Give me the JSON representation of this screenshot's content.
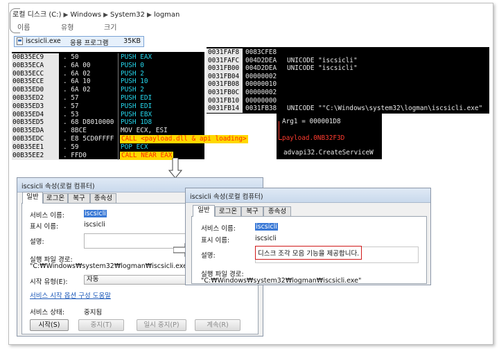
{
  "explorer": {
    "breadcrumb": [
      "로컬 디스크 (C:)",
      "Windows",
      "System32",
      "logman"
    ],
    "columns": {
      "name": "이름",
      "type": "유형",
      "size": "크기"
    },
    "file": {
      "name": "iscsicli.exe",
      "type": "응용 프로그램",
      "size": "35KB"
    }
  },
  "disasm": [
    {
      "addr": "00B35EC9",
      "hex": ". 50",
      "asm": "PUSH EAX",
      "style": "cyan"
    },
    {
      "addr": "00B35ECA",
      "hex": ". 6A 00",
      "asm": "PUSH 0",
      "style": "cyan"
    },
    {
      "addr": "00B35ECC",
      "hex": ". 6A 02",
      "asm": "PUSH 2",
      "style": "cyan"
    },
    {
      "addr": "00B35ECE",
      "hex": ". 6A 10",
      "asm": "PUSH 10",
      "style": "cyan"
    },
    {
      "addr": "00B35ED0",
      "hex": ". 6A 02",
      "asm": "PUSH 2",
      "style": "cyan"
    },
    {
      "addr": "00B35ED2",
      "hex": ". 57",
      "asm": "PUSH EDI",
      "style": "cyan"
    },
    {
      "addr": "00B35ED3",
      "hex": ". 57",
      "asm": "PUSH EDI",
      "style": "cyan"
    },
    {
      "addr": "00B35ED4",
      "hex": ". 53",
      "asm": "PUSH EBX",
      "style": "cyan"
    },
    {
      "addr": "00B35ED5",
      "hex": ". 68 D8010000",
      "asm": "PUSH 1D8",
      "style": "cyan"
    },
    {
      "addr": "00B35EDA",
      "hex": ". 8BCE",
      "asm": "MOV ECX, ESI",
      "style": "white"
    },
    {
      "addr": "00B35EDC",
      "hex": ". E8 5CD0FFFF",
      "asm": "CALL <payload.dll & api loading>",
      "style": "hl"
    },
    {
      "addr": "00B35EE1",
      "hex": ". 59",
      "asm": "POP ECX",
      "style": "cyan"
    },
    {
      "addr": "00B35EE2",
      "hex": ". FFD0",
      "asm": "CALL NEAR EAX",
      "style": "hl"
    }
  ],
  "stack": [
    {
      "addr": "0031FAF8",
      "val": "0083CFE8",
      "comment": ""
    },
    {
      "addr": "0031FAFC",
      "val": "004D2DEA",
      "comment": "UNICODE \"iscsicli\""
    },
    {
      "addr": "0031FB00",
      "val": "004D2DEA",
      "comment": "UNICODE \"iscsicli\""
    },
    {
      "addr": "0031FB04",
      "val": "00000002",
      "comment": ""
    },
    {
      "addr": "0031FB08",
      "val": "00000010",
      "comment": ""
    },
    {
      "addr": "0031FB0C",
      "val": "00000002",
      "comment": ""
    },
    {
      "addr": "0031FB10",
      "val": "00000000",
      "comment": ""
    },
    {
      "addr": "0031FB14",
      "val": "0031FB38",
      "comment": "UNICODE \"\"C:\\Windows\\system32\\logman\\iscsicli.exe\""
    }
  ],
  "args": {
    "arg1": "Arg1 = 000001D8",
    "payload": "payload.0NB32F3D",
    "api": "advapi32.CreateServiceW"
  },
  "dialog1": {
    "title": "iscsicli 속성(로컬 컴퓨터)",
    "tabs": [
      "일반",
      "로그온",
      "복구",
      "종속성"
    ],
    "service_name_label": "서비스 이름:",
    "service_name": "iscsicli",
    "display_name_label": "표시 이름:",
    "display_name": "iscsicli",
    "desc_label": "설명:",
    "exe_path_label": "실행 파일 경로:",
    "exe_path": "\"C:₩Windows₩system32₩logman₩iscsicli.exe\"",
    "startup_label": "시작 유형(E):",
    "startup_value": "자동",
    "help_link": "서비스 시작 옵션 구성 도움말",
    "status_label": "서비스 상태:",
    "status_value": "중지됨",
    "buttons": [
      "시작(S)",
      "중지(T)",
      "일시 중지(P)",
      "계속(R)"
    ]
  },
  "dialog2": {
    "title": "iscsicli 속성(로컬 컴퓨터)",
    "tabs": [
      "일반",
      "로그온",
      "복구",
      "종속성"
    ],
    "service_name_label": "서비스 이름:",
    "service_name": "iscsicli",
    "display_name_label": "표시 이름:",
    "display_name": "iscsicli",
    "desc_label": "설명:",
    "description": "디스크 조각 모음 기능을 제공합니다.",
    "exe_path_label": "실행 파일 경로:",
    "exe_path": "\"C:₩Windows₩system32₩logman₩iscsicli.exe\""
  },
  "colors": {
    "highlight_bg": "#ffd800",
    "highlight_fg": "#ff2a00",
    "cyan": "#26d9ef",
    "annotation_red": "#d01818",
    "selection": "#3a79d6"
  }
}
